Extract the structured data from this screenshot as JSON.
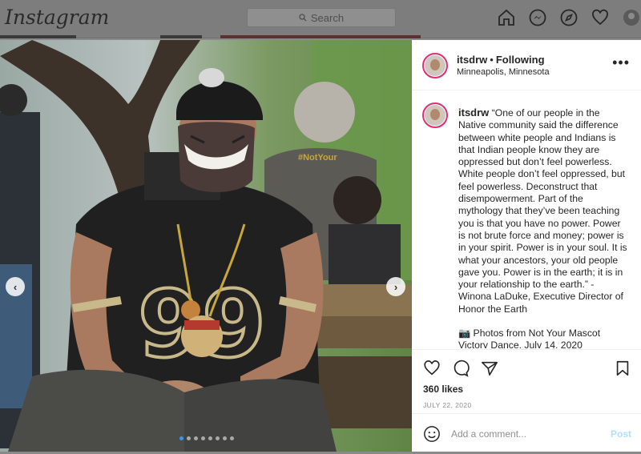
{
  "header": {
    "logo": "Instagram",
    "search_placeholder": "Search",
    "nav_icons": [
      "home-icon",
      "messenger-icon",
      "explore-icon",
      "activity-heart-icon",
      "profile-avatar"
    ]
  },
  "photo": {
    "carousel_total": 8,
    "carousel_active_index": 0
  },
  "post": {
    "username": "itsdrw",
    "separator": "•",
    "follow_state": "Following",
    "location": "Minneapolis, Minnesota",
    "more": "•••",
    "caption": "“One of our people in the Native community said the difference between white people and Indians is that Indian people know they are oppressed but don’t feel powerless. White people don’t feel oppressed, but feel powerless. Deconstruct that disempowerment. Part of the mythology that they’ve been teaching you is that you have no power. Power is not brute force and money; power is in your spirit. Power is in your soul. It is what your ancestors, your old people gave you. Power is in the earth; it is in your relationship to the earth.” - Winona LaDuke, Executive Director of Honor the Earth",
    "credits": "📷 Photos from Not Your Mascot Victory Dance, July 14, 2020",
    "likes": "360 likes",
    "date": "JULY 22, 2020",
    "comment_placeholder": "Add a comment...",
    "post_button": "Post"
  },
  "colors": {
    "accent_blue": "#3897f0",
    "post_disabled": "#b2dffc",
    "story_ring": "#e1306c"
  }
}
